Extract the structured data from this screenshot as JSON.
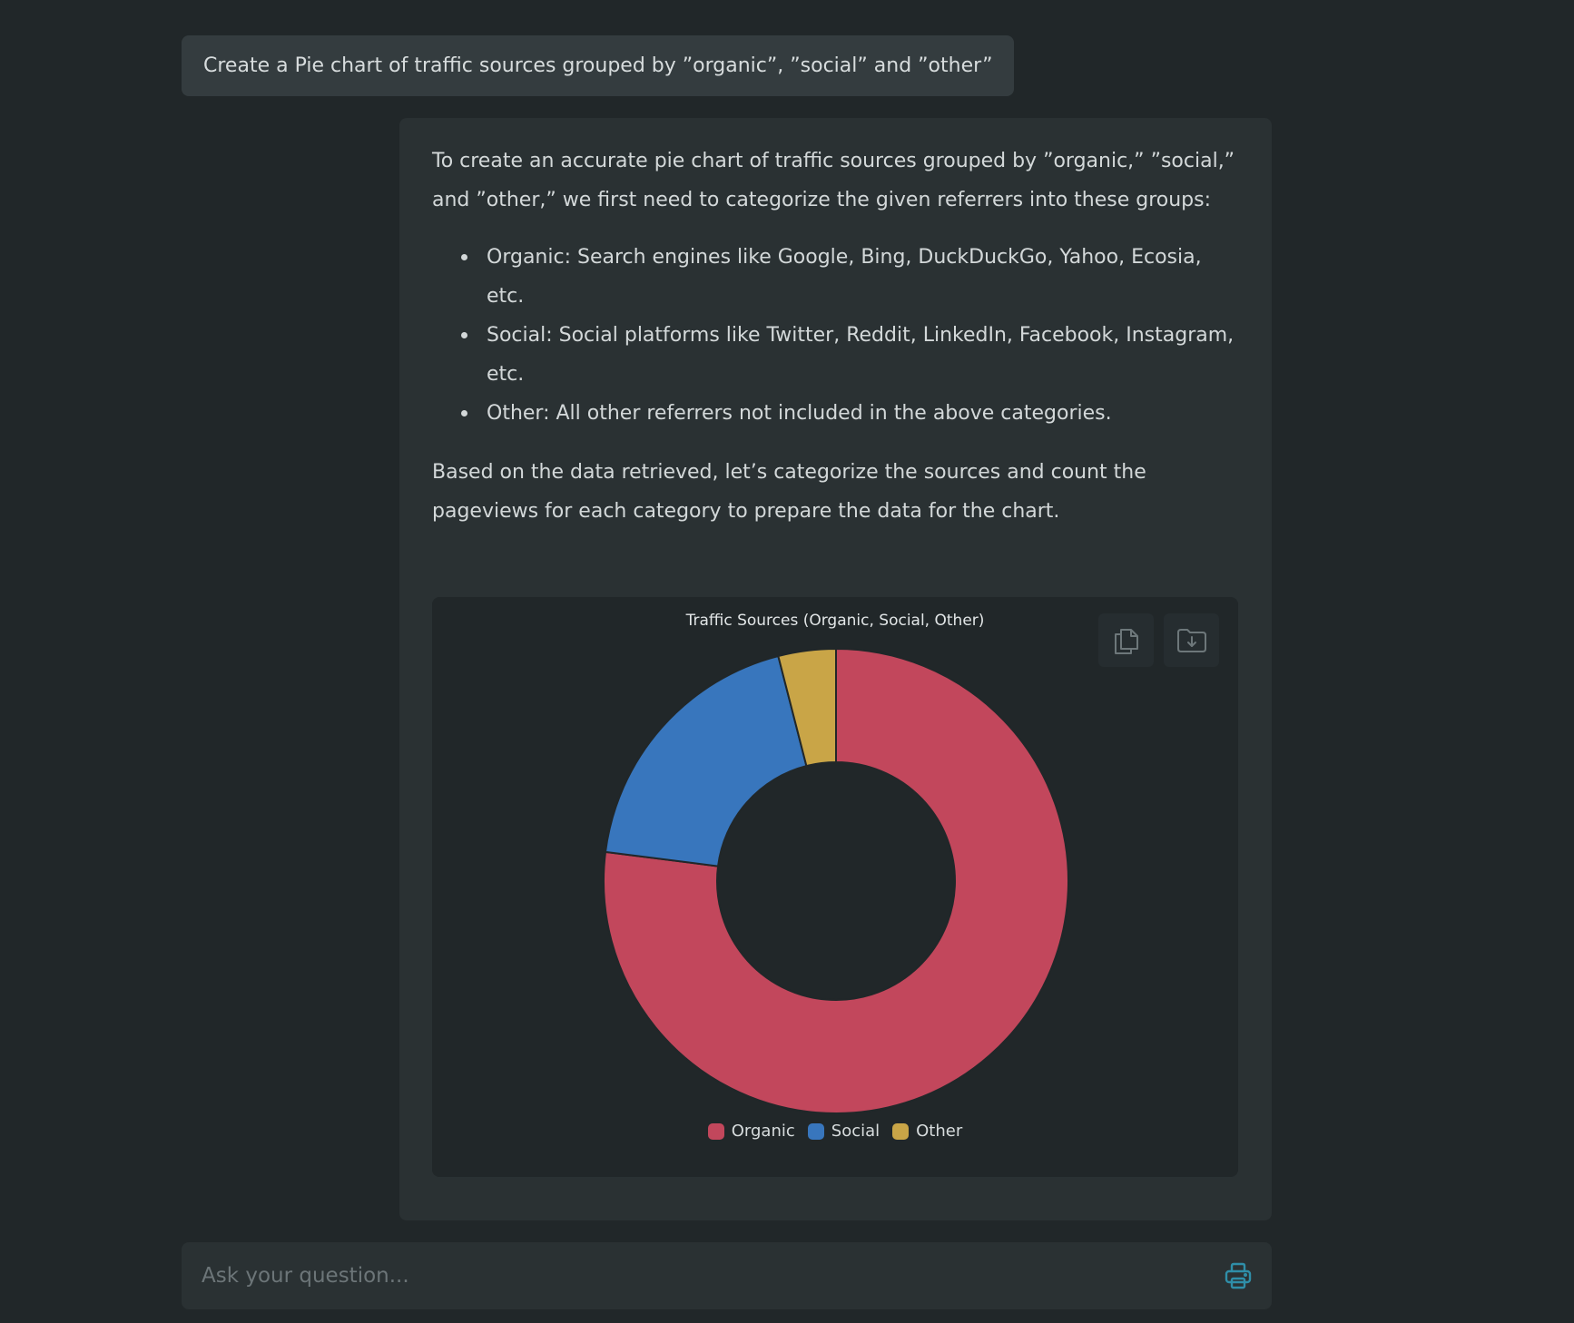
{
  "conversation": {
    "user_message": "Create a Pie chart of traffic sources grouped by ”organic”, ”social” and ”other”",
    "assistant": {
      "intro": "To create an accurate pie chart of traffic sources grouped by ”organic,” ”social,” and ”other,” we first need to categorize the given referrers into these groups:",
      "bullets": [
        "Organic: Search engines like Google, Bing, DuckDuckGo, Yahoo, Ecosia, etc.",
        "Social: Social platforms like Twitter, Reddit, LinkedIn, Facebook, Instagram, etc.",
        "Other: All other referrers not included in the above categories."
      ],
      "outro": "Based on the data retrieved, let’s categorize the sources and count the pageviews for each category to prepare the data for the chart."
    }
  },
  "chart_card": {
    "copy_icon": "copy-icon",
    "download_icon": "folder-download-icon"
  },
  "chart_data": {
    "type": "pie",
    "title": "Traffic Sources (Organic, Social, Other)",
    "categories": [
      "Organic",
      "Social",
      "Other"
    ],
    "values": [
      77,
      19,
      4
    ],
    "colors": [
      "#c2475c",
      "#3876bd",
      "#c9a547"
    ],
    "donut": true,
    "legend_position": "bottom-center"
  },
  "input": {
    "placeholder": "Ask your question...",
    "send_icon": "printer-icon",
    "accent_color": "#2f8ea8"
  }
}
